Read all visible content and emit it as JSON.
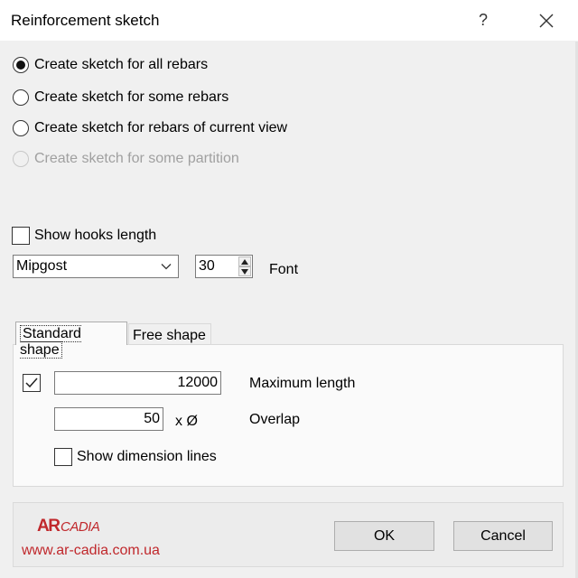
{
  "window": {
    "title": "Reinforcement sketch",
    "help_label": "?",
    "close_icon": "close-icon"
  },
  "options": [
    {
      "label": "Create sketch for all rebars",
      "selected": true,
      "enabled": true
    },
    {
      "label": "Create sketch for some rebars",
      "selected": false,
      "enabled": true
    },
    {
      "label": "Create sketch for rebars of current view",
      "selected": false,
      "enabled": true
    },
    {
      "label": "Create sketch for some partition",
      "selected": false,
      "enabled": false
    }
  ],
  "show_hooks": {
    "label": "Show hooks length",
    "checked": false
  },
  "font": {
    "selected": "Mipgost",
    "size": "30",
    "label": "Font"
  },
  "tabs": [
    {
      "label": "Standard shape",
      "active": true
    },
    {
      "label": "Free shape",
      "active": false
    }
  ],
  "standard_shape": {
    "max_length": {
      "checked": true,
      "value": "12000",
      "label": "Maximum length"
    },
    "overlap": {
      "value": "50",
      "multiplier": "x Ø",
      "label": "Overlap"
    },
    "show_dimension_lines": {
      "label": "Show dimension lines",
      "checked": false
    }
  },
  "footer": {
    "logo_text": "ARCADIA",
    "url": "www.ar-cadia.com.ua",
    "ok_label": "OK",
    "cancel_label": "Cancel"
  },
  "colors": {
    "brand_red": "#c0282c",
    "window_bg": "#f0f0f0",
    "title_bg": "#ffffff"
  }
}
